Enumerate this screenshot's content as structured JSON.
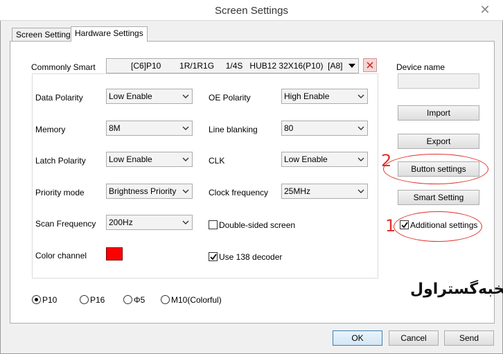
{
  "window": {
    "title": "Screen Settings"
  },
  "tabs": [
    {
      "label": "Screen Settings",
      "active": false
    },
    {
      "label": "Hardware Settings",
      "active": true
    }
  ],
  "commonly_smart": {
    "label": "Commonly Smart",
    "value": "[C6]P10        1R/1R1G     1/4S   HUB12 32X16(P10)  [A8]"
  },
  "left_fields": [
    {
      "label": "Data Polarity",
      "value": "Low Enable"
    },
    {
      "label": "Memory",
      "value": "8M"
    },
    {
      "label": "Latch Polarity",
      "value": "Low Enable"
    },
    {
      "label": "Priority mode",
      "value": "Brightness Priority"
    },
    {
      "label": "Scan Frequency",
      "value": "200Hz"
    }
  ],
  "color_channel": {
    "label": "Color channel",
    "color": "#ff0000"
  },
  "right_fields": [
    {
      "label": "OE Polarity",
      "value": "High Enable"
    },
    {
      "label": "Line blanking",
      "value": "80"
    },
    {
      "label": "CLK",
      "value": "Low Enable"
    },
    {
      "label": "Clock frequency",
      "value": "25MHz"
    }
  ],
  "checkboxes": [
    {
      "label": "Double-sided screen",
      "checked": false
    },
    {
      "label": "Use 138 decoder",
      "checked": true
    }
  ],
  "radios": [
    {
      "label": "P10",
      "selected": true
    },
    {
      "label": "P16",
      "selected": false
    },
    {
      "label": "Φ5",
      "selected": false
    },
    {
      "label": "M10(Colorful)",
      "selected": false
    }
  ],
  "side_panel": {
    "device_name_label": "Device name",
    "device_name_value": "",
    "buttons": [
      "Import",
      "Export",
      "Button settings",
      "Smart Setting"
    ],
    "additional_settings": {
      "label": "Additional settings",
      "checked": true
    }
  },
  "annotations": [
    "2",
    "1"
  ],
  "logo_text": "نخبه‌گستراول",
  "footer_buttons": [
    "OK",
    "Cancel",
    "Send"
  ],
  "colors": {
    "annotation": "#e0302a",
    "accent": "#3c7fb1"
  }
}
